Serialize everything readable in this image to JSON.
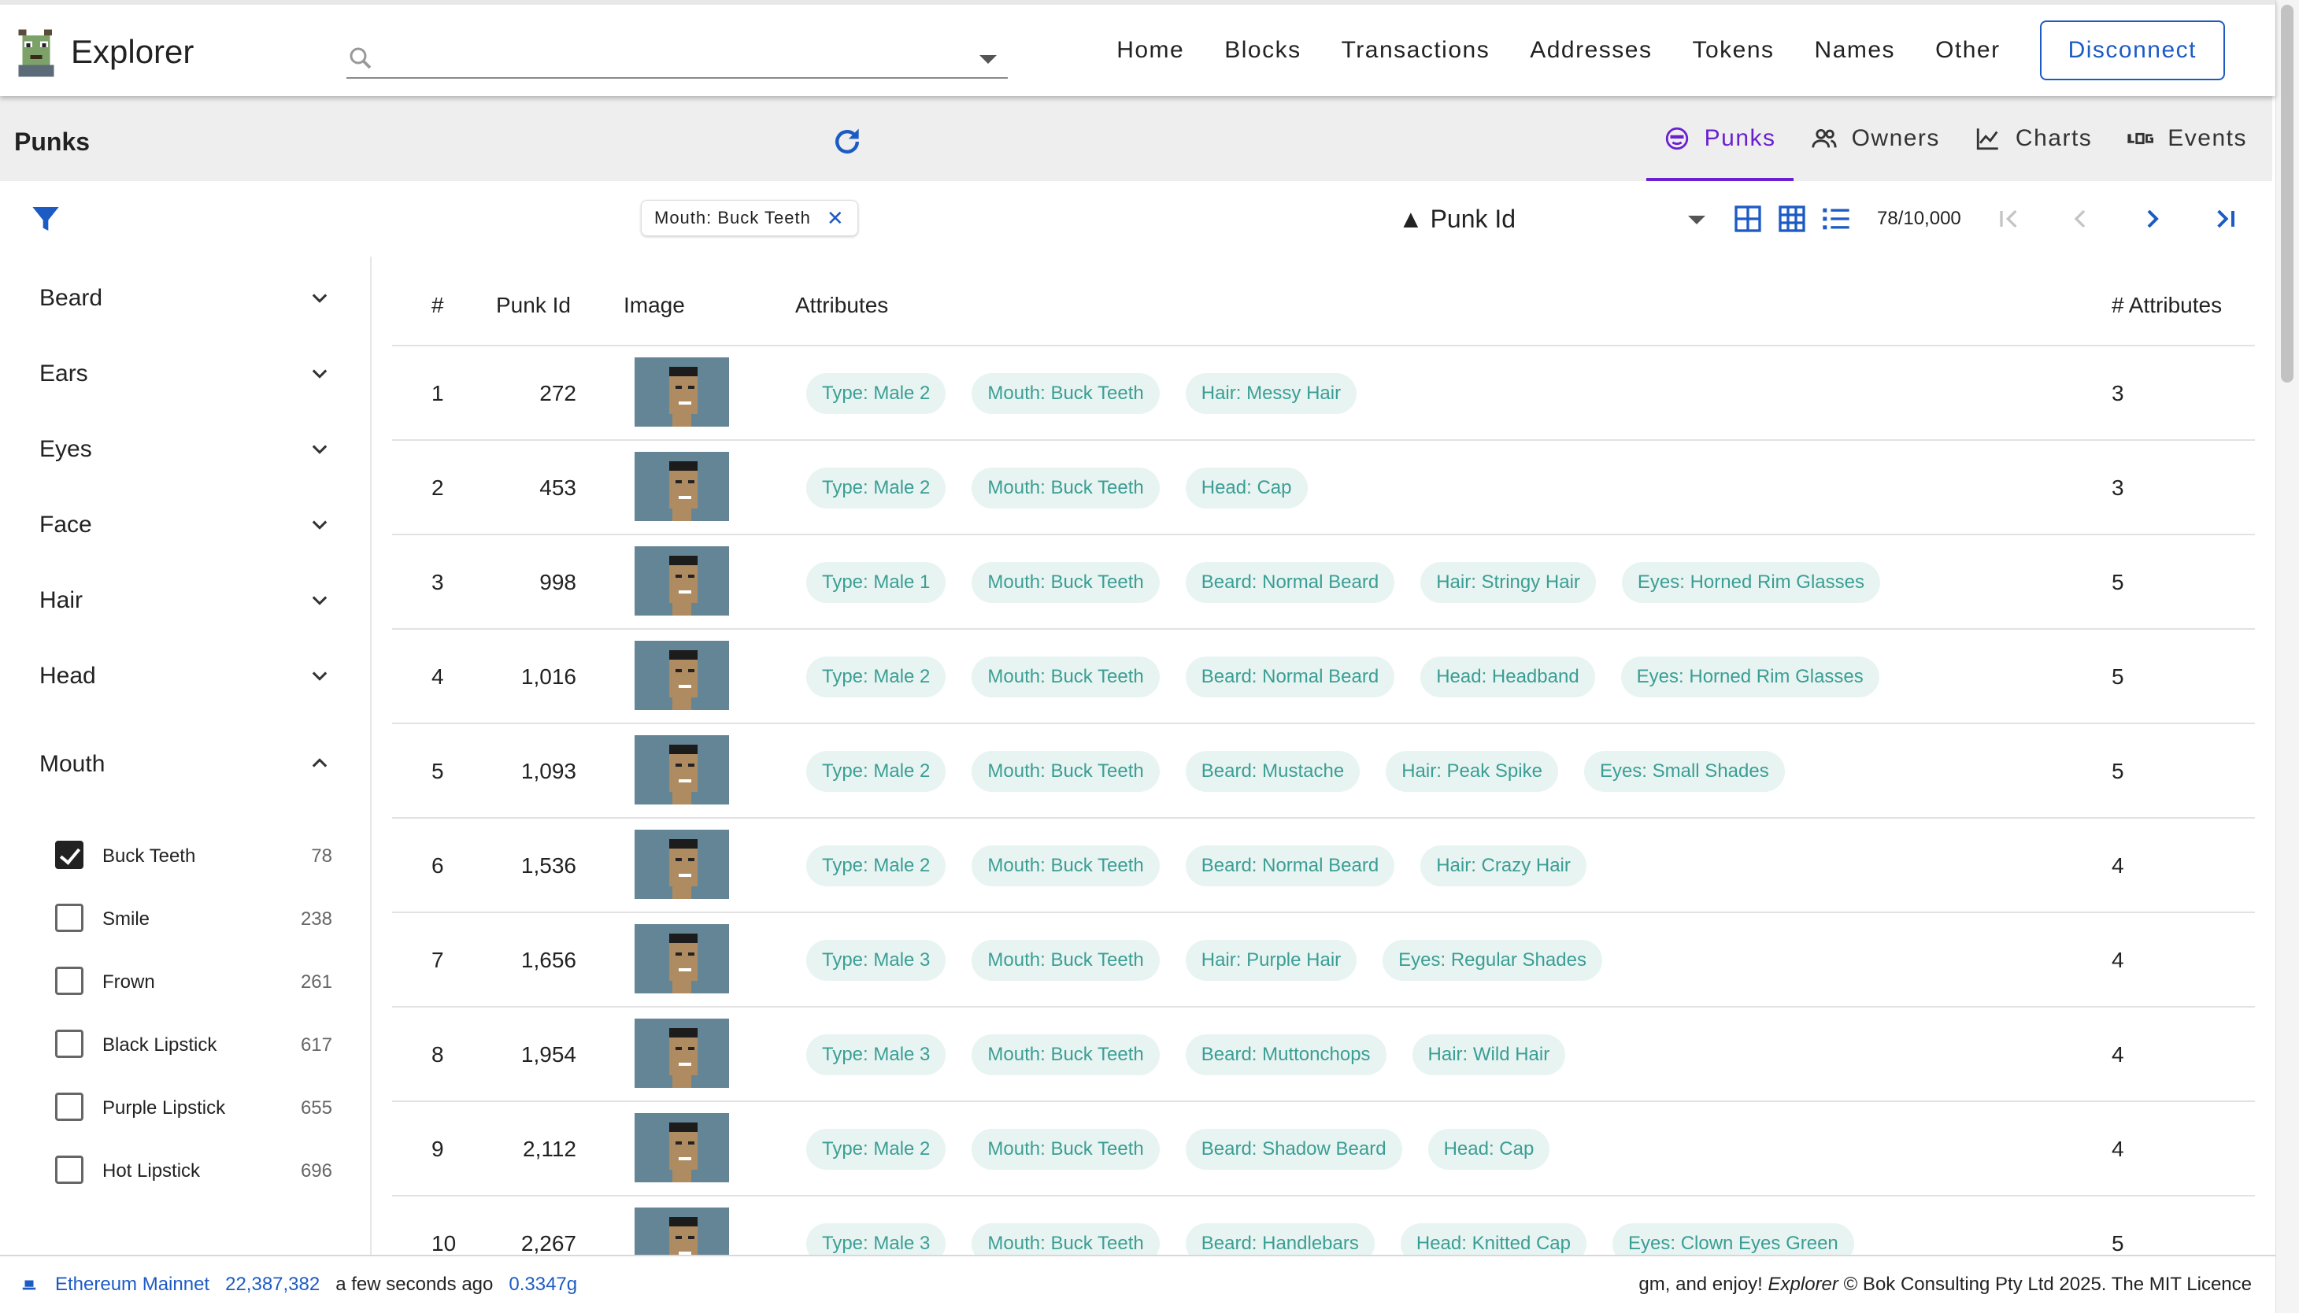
{
  "app": {
    "title": "Explorer",
    "search": {
      "placeholder": "",
      "value": ""
    },
    "nav": [
      "Home",
      "Blocks",
      "Transactions",
      "Addresses",
      "Tokens",
      "Names",
      "Other"
    ],
    "disconnect_label": "Disconnect"
  },
  "section": {
    "title": "Punks",
    "tabs": [
      {
        "label": "Punks",
        "icon": "punk-face-icon",
        "active": true
      },
      {
        "label": "Owners",
        "icon": "people-icon",
        "active": false
      },
      {
        "label": "Charts",
        "icon": "line-chart-icon",
        "active": false
      },
      {
        "label": "Events",
        "icon": "log-icon",
        "active": false
      }
    ]
  },
  "toolbar": {
    "filter_chip": "Mouth: Buck Teeth",
    "sort_label": "▲ Punk Id",
    "count": "78/10,000"
  },
  "sidebar": {
    "groups": [
      "Beard",
      "Ears",
      "Eyes",
      "Face",
      "Hair",
      "Head",
      "Mouth"
    ],
    "mouth_options": [
      {
        "label": "Buck Teeth",
        "count": "78",
        "checked": true
      },
      {
        "label": "Smile",
        "count": "238",
        "checked": false
      },
      {
        "label": "Frown",
        "count": "261",
        "checked": false
      },
      {
        "label": "Black Lipstick",
        "count": "617",
        "checked": false
      },
      {
        "label": "Purple Lipstick",
        "count": "655",
        "checked": false
      },
      {
        "label": "Hot Lipstick",
        "count": "696",
        "checked": false
      }
    ]
  },
  "table": {
    "headers": {
      "index": "#",
      "punk_id": "Punk Id",
      "image": "Image",
      "attributes": "Attributes",
      "count": "# Attributes"
    },
    "rows": [
      {
        "index": "1",
        "punk_id": "272",
        "attributes": [
          "Type: Male 2",
          "Mouth: Buck Teeth",
          "Hair: Messy Hair"
        ],
        "count": "3"
      },
      {
        "index": "2",
        "punk_id": "453",
        "attributes": [
          "Type: Male 2",
          "Mouth: Buck Teeth",
          "Head: Cap"
        ],
        "count": "3"
      },
      {
        "index": "3",
        "punk_id": "998",
        "attributes": [
          "Type: Male 1",
          "Mouth: Buck Teeth",
          "Beard: Normal Beard",
          "Hair: Stringy Hair",
          "Eyes: Horned Rim Glasses"
        ],
        "count": "5"
      },
      {
        "index": "4",
        "punk_id": "1,016",
        "attributes": [
          "Type: Male 2",
          "Mouth: Buck Teeth",
          "Beard: Normal Beard",
          "Head: Headband",
          "Eyes: Horned Rim Glasses"
        ],
        "count": "5"
      },
      {
        "index": "5",
        "punk_id": "1,093",
        "attributes": [
          "Type: Male 2",
          "Mouth: Buck Teeth",
          "Beard: Mustache",
          "Hair: Peak Spike",
          "Eyes: Small Shades"
        ],
        "count": "5"
      },
      {
        "index": "6",
        "punk_id": "1,536",
        "attributes": [
          "Type: Male 2",
          "Mouth: Buck Teeth",
          "Beard: Normal Beard",
          "Hair: Crazy Hair"
        ],
        "count": "4"
      },
      {
        "index": "7",
        "punk_id": "1,656",
        "attributes": [
          "Type: Male 3",
          "Mouth: Buck Teeth",
          "Hair: Purple Hair",
          "Eyes: Regular Shades"
        ],
        "count": "4"
      },
      {
        "index": "8",
        "punk_id": "1,954",
        "attributes": [
          "Type: Male 3",
          "Mouth: Buck Teeth",
          "Beard: Muttonchops",
          "Hair: Wild Hair"
        ],
        "count": "4"
      },
      {
        "index": "9",
        "punk_id": "2,112",
        "attributes": [
          "Type: Male 2",
          "Mouth: Buck Teeth",
          "Beard: Shadow Beard",
          "Head: Cap"
        ],
        "count": "4"
      },
      {
        "index": "10",
        "punk_id": "2,267",
        "attributes": [
          "Type: Male 3",
          "Mouth: Buck Teeth",
          "Beard: Handlebars",
          "Head: Knitted Cap",
          "Eyes: Clown Eyes Green"
        ],
        "count": "5"
      }
    ]
  },
  "footer": {
    "network": "Ethereum Mainnet",
    "block": "22,387,382",
    "time": "a few seconds ago",
    "gas": "0.3347g",
    "credit_prefix": "gm, and enjoy!",
    "credit_app": "Explorer",
    "credit_suffix": "© Bok Consulting Pty Ltd 2025. The MIT Licence"
  },
  "colors": {
    "accent": "#1d5bc4",
    "tab_active": "#6a1fd1",
    "chip_bg": "#e8f4f2",
    "chip_text": "#3a9e94",
    "punk_bg": "#648595"
  }
}
